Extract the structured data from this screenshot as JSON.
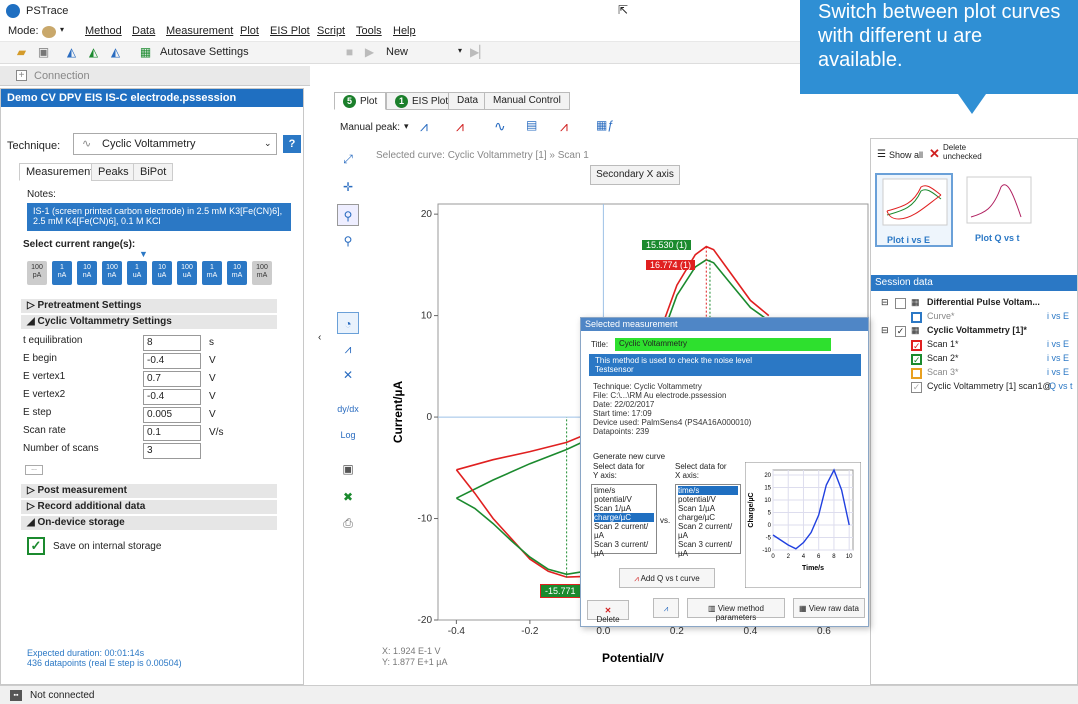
{
  "app": {
    "title": "PSTrace"
  },
  "menu": {
    "mode": "Mode:",
    "items": [
      "Method",
      "Data",
      "Measurement",
      "Plot",
      "EIS Plot",
      "Script",
      "Tools",
      "Help"
    ]
  },
  "toolbar": {
    "autosave": "Autosave Settings",
    "run_mode": "New"
  },
  "connection": {
    "label": "Connection"
  },
  "left": {
    "header": "Demo CV DPV EIS IS-C electrode.pssession",
    "technique_label": "Technique:",
    "technique_value": "Cyclic Voltammetry",
    "help": "?",
    "tabs": [
      "Measurement",
      "Peaks",
      "BiPot"
    ],
    "notes_label": "Notes:",
    "notes_text": "IS-1 (screen printed carbon electrode) in 2.5 mM K3[Fe(CN)6], 2.5 mM K4[Fe(CN)6], 0.1 M KCl",
    "range_label": "Select current range(s):",
    "ranges": [
      {
        "v": "100",
        "u": "pA"
      },
      {
        "v": "1",
        "u": "nA"
      },
      {
        "v": "10",
        "u": "nA"
      },
      {
        "v": "100",
        "u": "nA"
      },
      {
        "v": "1",
        "u": "uA"
      },
      {
        "v": "10",
        "u": "uA"
      },
      {
        "v": "100",
        "u": "uA"
      },
      {
        "v": "1",
        "u": "mA"
      },
      {
        "v": "10",
        "u": "mA"
      },
      {
        "v": "100",
        "u": "mA"
      }
    ],
    "sections": {
      "pretreatment": "Pretreatment Settings",
      "cv": "Cyclic Voltammetry Settings",
      "post": "Post measurement",
      "record": "Record additional data",
      "storage": "On-device storage"
    },
    "params": [
      {
        "label": "t equilibration",
        "value": "8",
        "unit": "s"
      },
      {
        "label": "E begin",
        "value": "-0.4",
        "unit": "V"
      },
      {
        "label": "E vertex1",
        "value": "0.7",
        "unit": "V"
      },
      {
        "label": "E vertex2",
        "value": "-0.4",
        "unit": "V"
      },
      {
        "label": "E step",
        "value": "0.005",
        "unit": "V"
      },
      {
        "label": "Scan rate",
        "value": "0.1",
        "unit": "V/s"
      },
      {
        "label": "Number of scans",
        "value": "3",
        "unit": ""
      }
    ],
    "more": "...",
    "save_internal": "Save on internal storage",
    "duration": "Expected duration: 00:01:14s",
    "datapoints": "436 datapoints (real E step is 0.00504)"
  },
  "plot_tabs": [
    {
      "num": "5",
      "label": "Plot"
    },
    {
      "num": "1",
      "label": "EIS Plot"
    },
    {
      "num": "",
      "label": "Data"
    },
    {
      "num": "",
      "label": "Manual Control"
    }
  ],
  "manual_peak": "Manual peak:",
  "plot": {
    "selected_curve": "Selected curve: Cyclic Voltammetry [1] » Scan 1",
    "secondary_axis": "Secondary X axis",
    "peak_top_red": "16.774 (1)",
    "peak_top_green": "15.530 (1)",
    "peak_bottom": "-15.771",
    "cursor_x": "X: 1.924 E-1 V",
    "cursor_y": "Y: 1.877 E+1 µA"
  },
  "chart_data": {
    "type": "line",
    "xlabel": "Potential/V",
    "ylabel": "Current/µA",
    "xlim": [
      -0.45,
      0.72
    ],
    "ylim": [
      -20,
      21
    ],
    "x_ticks": [
      "-0.4",
      "-0.2",
      "0.0",
      "0.2",
      "0.4",
      "0.6"
    ],
    "y_ticks": [
      "-20",
      "-10",
      "0",
      "10",
      "20"
    ],
    "series": [
      {
        "color": "#e02020",
        "x": [
          -0.4,
          -0.3,
          -0.2,
          -0.1,
          0.0,
          0.05,
          0.1,
          0.15,
          0.2,
          0.25,
          0.28,
          0.3,
          0.35,
          0.4,
          0.45
        ],
        "y": [
          -5.2,
          -4.2,
          -3.4,
          -2.5,
          -1.0,
          0.5,
          3.5,
          8.0,
          13.0,
          16.0,
          16.8,
          16.5,
          14.0,
          11.5,
          10.0
        ]
      },
      {
        "color": "#1b8a2e",
        "x": [
          -0.4,
          -0.3,
          -0.2,
          -0.1,
          0.0,
          0.05,
          0.1,
          0.15,
          0.2,
          0.25,
          0.28,
          0.3,
          0.35,
          0.4,
          0.45
        ],
        "y": [
          -8.0,
          -6.2,
          -4.6,
          -3.2,
          -1.5,
          0.0,
          2.8,
          7.0,
          12.0,
          14.8,
          15.5,
          15.2,
          13.0,
          10.8,
          9.5
        ]
      },
      {
        "color": "#e02020",
        "x": [
          0.0,
          -0.05,
          -0.1,
          -0.15,
          -0.2,
          -0.25,
          -0.3,
          -0.35,
          -0.4
        ],
        "y": [
          -15.0,
          -15.7,
          -15.77,
          -15.2,
          -14.0,
          -12.0,
          -10.0,
          -7.5,
          -5.2
        ]
      },
      {
        "color": "#1b8a2e",
        "x": [
          0.0,
          -0.05,
          -0.1,
          -0.15,
          -0.2,
          -0.25,
          -0.3,
          -0.35,
          -0.4
        ],
        "y": [
          -14.5,
          -15.2,
          -15.5,
          -15.0,
          -13.8,
          -12.2,
          -10.5,
          -9.0,
          -8.0
        ]
      }
    ]
  },
  "right": {
    "show_all": "Show all",
    "delete_unchecked": "Delete unchecked",
    "thumb1": "Plot i vs E",
    "thumb2": "Plot Q vs t",
    "session_header": "Session data",
    "tree": [
      {
        "label": "Differential Pulse Voltam...",
        "right": ""
      },
      {
        "label": "Curve*",
        "right": "i vs E"
      },
      {
        "label": "Cyclic Voltammetry [1]*",
        "right": ""
      },
      {
        "label": "Scan 1*",
        "right": "i vs E"
      },
      {
        "label": "Scan 2*",
        "right": "i vs E"
      },
      {
        "label": "Scan 3*",
        "right": "i vs E"
      },
      {
        "label": "Cyclic Voltammetry [1] scan1@",
        "right": "Q vs t"
      }
    ]
  },
  "popup": {
    "header": "Selected measurement",
    "title_label": "Title:",
    "title_value": "Cyclic Voltammetry",
    "description": "This method is used to check the noise level\nTestsensor",
    "info": [
      "Technique: Cyclic Voltammetry",
      "File: C:\\...\\RM Au electrode.pssession",
      "Date: 22/02/2017",
      "Start time: 17:09",
      "Device used: PalmSens4 (PS4A16A000010)",
      "Datapoints: 239"
    ],
    "generate": "Generate new curve",
    "sel_y": "Select data for Y axis:",
    "sel_x": "Select data for X axis:",
    "vs": "vs.",
    "ylist": [
      "time/s",
      "potential/V",
      "Scan 1/µA",
      "charge/µC",
      "Scan 2 current/µA",
      "Scan 3 current/µA"
    ],
    "xlist": [
      "time/s",
      "potential/V",
      "Scan 1/µA",
      "charge/µC",
      "Scan 2 current/µA",
      "Scan 3 current/µA"
    ],
    "add_curve": "Add Q vs t curve",
    "delete": "Delete",
    "view_params": "View method parameters",
    "view_raw": "View raw data",
    "mini_ylabel": "Charge/µC",
    "mini_xlabel": "Time/s",
    "mini_x_ticks": [
      "0",
      "2",
      "4",
      "6",
      "8",
      "10"
    ],
    "mini_y_ticks": [
      "20",
      "15",
      "10",
      "5",
      "0",
      "-5",
      "-10"
    ]
  },
  "mini_chart": {
    "type": "line",
    "x": [
      0,
      1,
      2,
      3,
      4,
      5,
      6,
      7,
      8,
      9,
      10
    ],
    "y": [
      -4,
      -6,
      -8,
      -9.5,
      -7,
      -3,
      4,
      16,
      22,
      14,
      0
    ],
    "xlim": [
      0,
      10.5
    ],
    "ylim": [
      -10,
      22
    ]
  },
  "callout": {
    "text": "Switch between plot curves with different u are available."
  },
  "status": {
    "text": "Not connected"
  },
  "colors": {
    "accent": "#1f6fc1",
    "red": "#e02020",
    "green": "#1b8a2e",
    "callout": "#2f8fd4"
  }
}
